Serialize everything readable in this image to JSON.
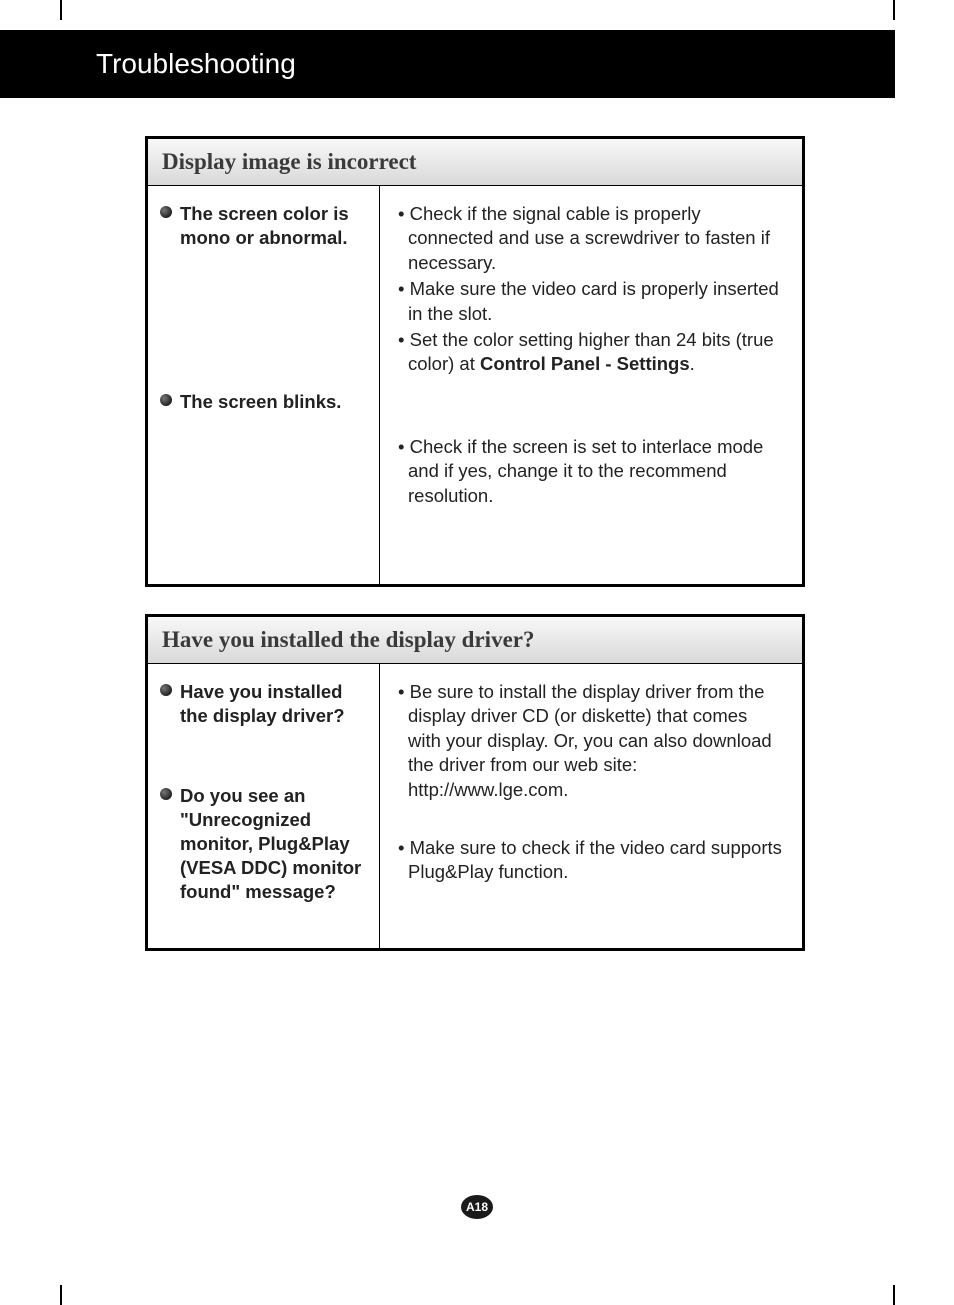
{
  "title": "Troubleshooting",
  "page_number": "A18",
  "sections": [
    {
      "header": "Display image is incorrect",
      "rows": [
        {
          "problem": "The screen color is mono or abnormal.",
          "solutions": [
            "Check if the signal cable is properly connected and use a screwdriver to fasten if necessary.",
            "Make sure the video card is properly inserted in the slot.",
            "Set the color setting higher than 24 bits (true color) at <b>Control Panel - Settings</b>."
          ]
        },
        {
          "problem": "The screen blinks.",
          "solutions": [
            "Check if the screen is set to interlace mode and if yes, change it to the recommend resolution."
          ]
        }
      ]
    },
    {
      "header": "Have you installed the display driver?",
      "rows": [
        {
          "problem": "Have you installed the display driver?",
          "solutions": [
            "Be sure to install the display driver from the display driver CD (or diskette) that comes with your display. Or, you can also download the driver from our web site: http://www.lge.com."
          ]
        },
        {
          "problem": "Do you see an \"Unrecognized monitor, Plug&Play (VESA DDC) monitor found\" message?",
          "solutions": [
            "Make sure to check if the video card supports Plug&Play function."
          ]
        }
      ]
    }
  ]
}
